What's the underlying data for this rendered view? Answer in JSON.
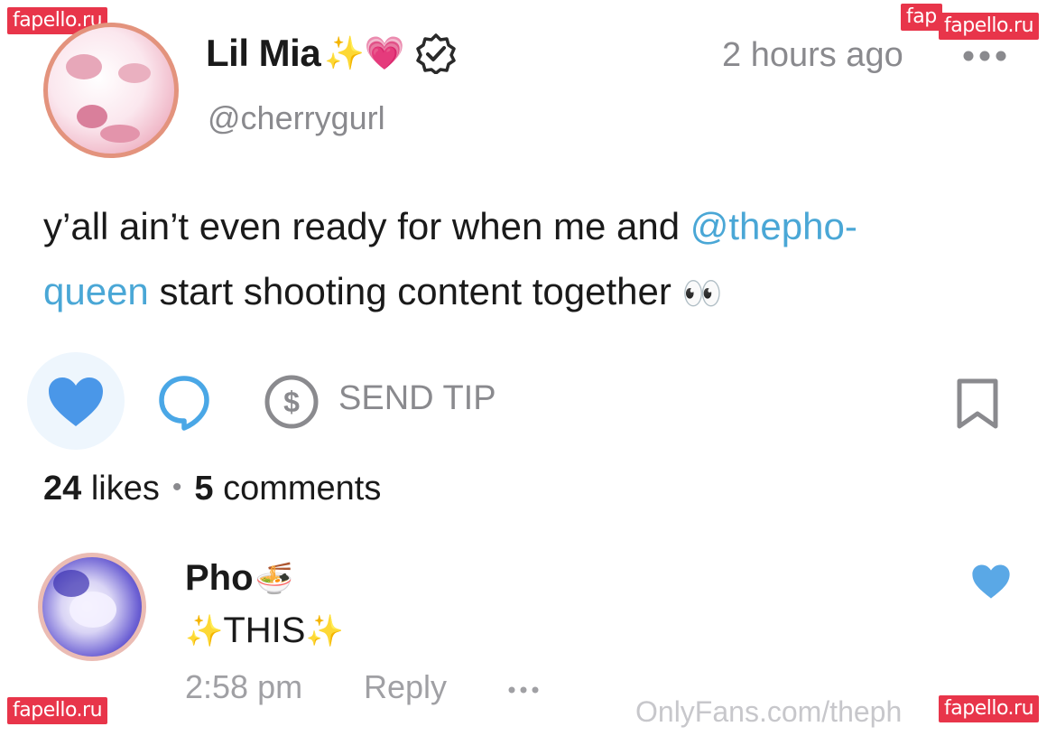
{
  "post": {
    "author_name": "Lil Mia",
    "author_emoji": "✨💗",
    "handle": "@cherrygurl",
    "time": "2 hours ago",
    "text_before": "y’all ain’t even ready for when me and ",
    "mention": "@thepho-queen",
    "mention_line1": "@thepho-",
    "mention_line2": "queen",
    "text_after": " start shooting content together ",
    "text_emoji": "👀"
  },
  "actions": {
    "send_tip_label": "SEND TIP",
    "like_active_color": "#4a97e8"
  },
  "stats": {
    "likes_count": "24",
    "likes_label": "likes",
    "separator": "•",
    "comments_count": "5",
    "comments_label": "comments"
  },
  "comment": {
    "author_name": "Pho",
    "author_emoji": "🍜",
    "text": "THIS",
    "sparkle": "✨",
    "time": "2:58 pm",
    "reply_label": "Reply",
    "liked_color": "#5aa8e6"
  },
  "watermarks": {
    "site": "fapello.ru",
    "site_partial": "fap",
    "footer": "OnlyFans.com/theph"
  },
  "icons": [
    "verified-icon",
    "more-dots-icon",
    "heart-icon",
    "comment-icon",
    "dollar-icon",
    "bookmark-icon"
  ]
}
